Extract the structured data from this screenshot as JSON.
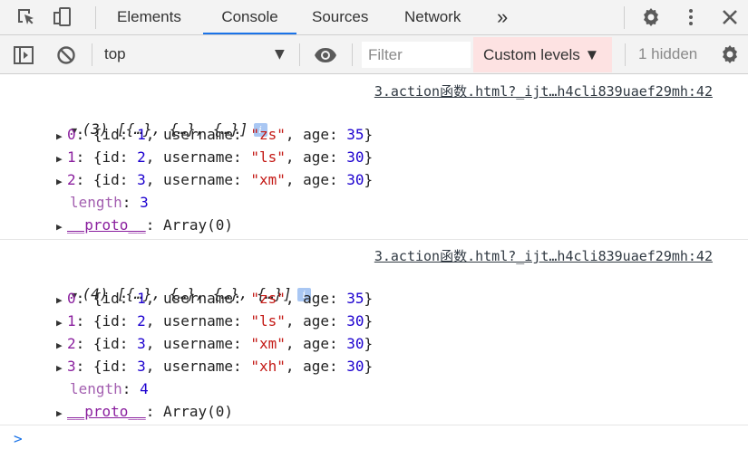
{
  "tabs": {
    "elements": "Elements",
    "console": "Console",
    "sources": "Sources",
    "network": "Network",
    "more": "»"
  },
  "toolbar": {
    "context": "top",
    "filter_placeholder": "Filter",
    "levels": "Custom levels ▼",
    "hidden": "1 hidden"
  },
  "messages": [
    {
      "source": "3.action函数.html?_ijt…h4cli839uaef29mh:42",
      "summary_count": "(3)",
      "summary_items": " [{…}, {…}, {…}]",
      "items": [
        {
          "index": "0",
          "id": "1",
          "username": "\"zs\"",
          "age": "35"
        },
        {
          "index": "1",
          "id": "2",
          "username": "\"ls\"",
          "age": "30"
        },
        {
          "index": "2",
          "id": "3",
          "username": "\"xm\"",
          "age": "30"
        }
      ],
      "length_label": "length",
      "length": "3",
      "proto_label": "__proto__",
      "proto_value": "Array(0)"
    },
    {
      "source": "3.action函数.html?_ijt…h4cli839uaef29mh:42",
      "summary_count": "(4)",
      "summary_items": " [{…}, {…}, {…}, {…}]",
      "items": [
        {
          "index": "0",
          "id": "1",
          "username": "\"zs\"",
          "age": "35"
        },
        {
          "index": "1",
          "id": "2",
          "username": "\"ls\"",
          "age": "30"
        },
        {
          "index": "2",
          "id": "3",
          "username": "\"xm\"",
          "age": "30"
        },
        {
          "index": "3",
          "id": "3",
          "username": "\"xh\"",
          "age": "30"
        }
      ],
      "length_label": "length",
      "length": "4",
      "proto_label": "__proto__",
      "proto_value": "Array(0)"
    }
  ],
  "prompt": ">"
}
